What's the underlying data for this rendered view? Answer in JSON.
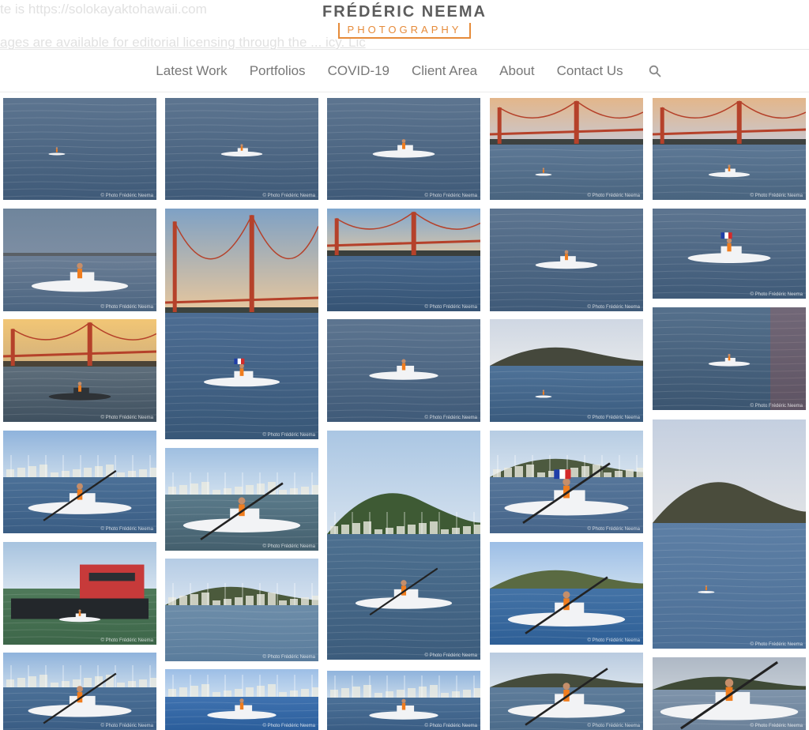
{
  "background_text": {
    "line1": "te is  https://solokayaktohawaii.com",
    "line2": "ages are available for editorial licensing through the ... icy. Lic"
  },
  "logo": {
    "name": "FRÉDÉRIC NEEMA",
    "subtitle": "PHOTOGRAPHY"
  },
  "nav": {
    "items": [
      "Latest Work",
      "Portfolios",
      "COVID-19",
      "Client Area",
      "About",
      "Contact Us"
    ],
    "search_icon": "search-icon"
  },
  "gallery": {
    "watermark": "© Photo Frédéric Neema",
    "tiles": [
      {
        "scene": "water",
        "boat": "tiny"
      },
      {
        "scene": "water",
        "boat": "small"
      },
      {
        "scene": "water",
        "boat": "medium"
      },
      {
        "scene": "bridge-sunset",
        "boat": "tiny"
      },
      {
        "scene": "bridge-sunset",
        "boat": "small"
      },
      {
        "scene": "water-shore",
        "boat": "large"
      },
      {
        "scene": "bridge-tall",
        "boat": "small-flag"
      },
      {
        "scene": "bridge-wide",
        "boat": "none"
      },
      {
        "scene": "water",
        "boat": "medium"
      },
      {
        "scene": "water",
        "boat": "flag"
      },
      {
        "scene": "sunset-city",
        "boat": "dark"
      },
      {
        "scene": "water",
        "boat": "front"
      },
      {
        "scene": "island",
        "boat": "tiny"
      },
      {
        "scene": "water-red",
        "boat": "small"
      },
      {
        "scene": "marina",
        "boat": "kayaker"
      },
      {
        "scene": "marina-close",
        "boat": "paddler"
      },
      {
        "scene": "hills-marina",
        "boat": "paddler-front"
      },
      {
        "scene": "marina-hill",
        "boat": "flag-paddler"
      },
      {
        "scene": "island-tall",
        "boat": "tiny"
      },
      {
        "scene": "tug",
        "boat": "small"
      },
      {
        "scene": "hills-town",
        "boat": "none"
      },
      {
        "scene": "hills-water",
        "boat": "paddler"
      },
      {
        "scene": "marina",
        "boat": "kayaker"
      },
      {
        "scene": "water-boat-front",
        "boat": "front"
      },
      {
        "scene": "marina",
        "boat": "front"
      },
      {
        "scene": "water-boat",
        "boat": "paddler"
      },
      {
        "scene": "boat-close",
        "boat": "closeup"
      },
      {
        "scene": "sky-mast",
        "boat": "mast"
      }
    ]
  },
  "colors": {
    "logo_orange": "#e68b3a",
    "nav_text": "#777777",
    "water": "#4f6f8f",
    "kayak_orange": "#f07d1e"
  }
}
